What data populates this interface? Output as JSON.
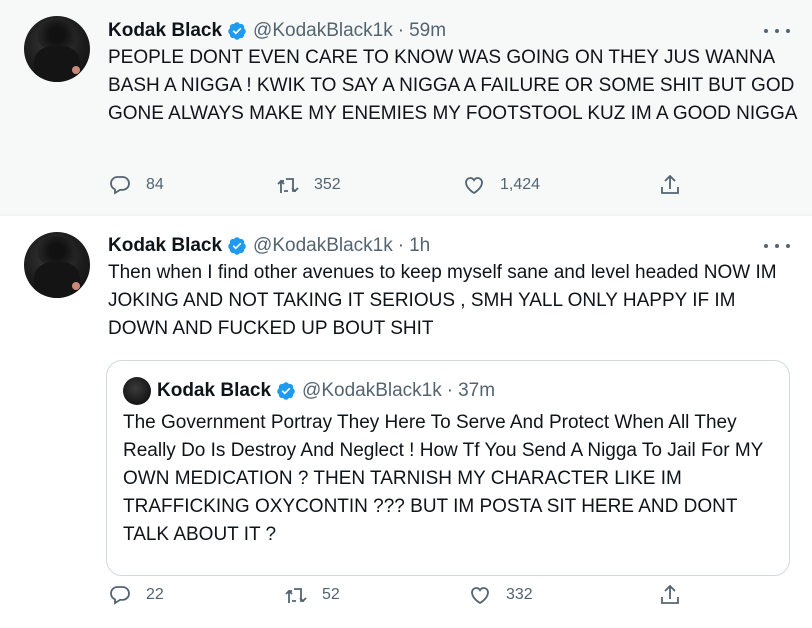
{
  "tweets": [
    {
      "author": "Kodak Black",
      "handle": "@KodakBlack1k",
      "separator": "·",
      "time": "59m",
      "text": "PEOPLE DONT EVEN CARE TO KNOW WAS GOING ON THEY JUS WANNA BASH A NIGGA ! KWIK TO SAY A NIGGA A FAILURE OR SOME SHIT BUT GOD GONE ALWAYS MAKE MY ENEMIES MY FOOTSTOOL KUZ IM A GOOD NIGGA",
      "replies": "84",
      "retweets": "352",
      "likes": "1,424"
    },
    {
      "author": "Kodak Black",
      "handle": "@KodakBlack1k",
      "separator": "·",
      "time": "1h",
      "text": "Then when I find other avenues to keep myself sane and level headed NOW IM JOKING AND NOT TAKING IT SERIOUS , SMH YALL ONLY HAPPY IF IM DOWN AND FUCKED UP BOUT SHIT",
      "quote": {
        "author": "Kodak Black",
        "handle": "@KodakBlack1k",
        "separator": "·",
        "time": "37m",
        "text": "The Government Portray They Here To Serve And Protect When All They Really Do Is Destroy And Neglect ! How Tf You Send A Nigga To Jail For MY OWN MEDICATION ? THEN TARNISH MY CHARACTER LIKE IM TRAFFICKING OXYCONTIN ??? BUT IM POSTA SIT HERE AND DONT TALK ABOUT IT ?"
      },
      "replies": "22",
      "retweets": "52",
      "likes": "332"
    }
  ],
  "icons": {
    "verified": "verified-badge-icon",
    "reply": "reply-icon",
    "retweet": "retweet-icon",
    "like": "heart-icon",
    "share": "share-icon",
    "more": "more-icon"
  },
  "colors": {
    "verified": "#1d9bf0",
    "muted": "#536471",
    "text": "#0f1419",
    "highlight_bg": "#f7f9f9",
    "border": "#cfd9de"
  }
}
